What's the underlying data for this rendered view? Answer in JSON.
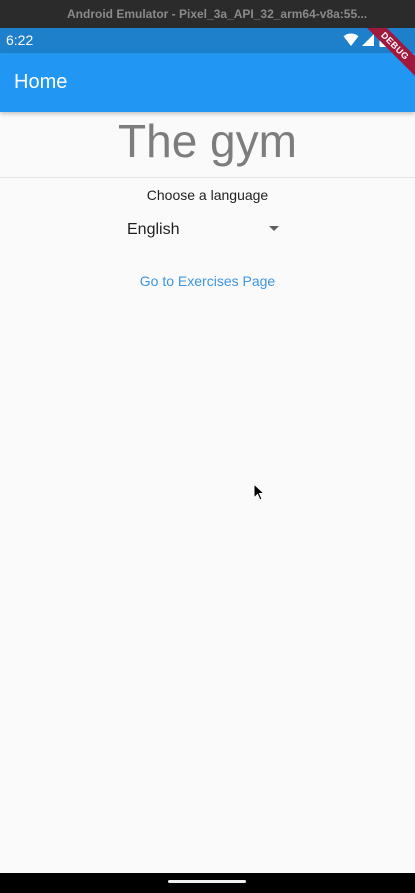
{
  "window": {
    "title": "Android Emulator - Pixel_3a_API_32_arm64-v8a:55..."
  },
  "status_bar": {
    "time": "6:22",
    "icons": [
      "wifi-icon",
      "signal-icon",
      "battery-icon"
    ],
    "color": "#1e7fcb"
  },
  "app_bar": {
    "title": "Home",
    "color": "#2196f3"
  },
  "debug_banner": {
    "label": "DEBUG",
    "color": "#a0183b"
  },
  "main": {
    "title": "The gym",
    "language_label": "Choose a language",
    "language_selected": "English",
    "exercises_link": "Go to Exercises Page"
  },
  "colors": {
    "link": "#3b96e0",
    "title_text": "#7d7d7d",
    "background": "#fafafa"
  }
}
